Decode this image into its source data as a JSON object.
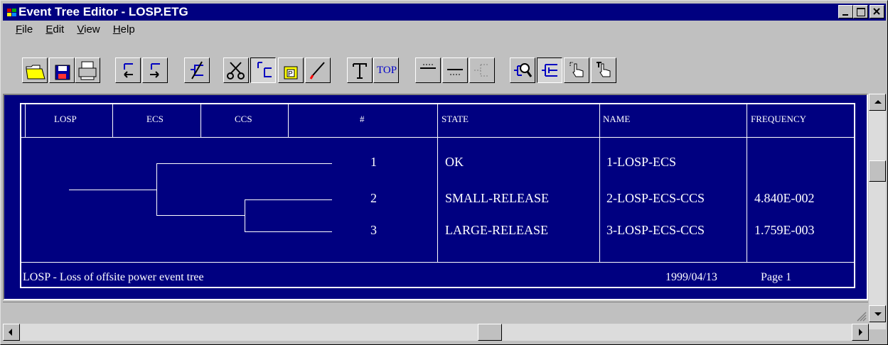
{
  "window": {
    "title": "Event Tree Editor - LOSP.ETG",
    "controls": [
      "minimize-icon",
      "maximize-icon",
      "close-icon"
    ]
  },
  "menu": [
    "File",
    "Edit",
    "View",
    "Help"
  ],
  "toolbar": {
    "top_label": "TOP",
    "buttons": [
      "open-icon",
      "save-icon",
      "print-icon",
      "move-left-icon",
      "move-right-icon",
      "branch-icon",
      "cut-icon",
      "copy-icon",
      "paste-icon",
      "draw-icon",
      "text-icon",
      "top-icon",
      "line-above-icon",
      "line-below-icon",
      "bracket-icon",
      "zoom-icon",
      "tree-icon",
      "hand-pointer-icon",
      "text-pointer-icon"
    ]
  },
  "table": {
    "headers": [
      "LOSP",
      "ECS",
      "CCS",
      "#",
      "STATE",
      "NAME",
      "FREQUENCY"
    ],
    "rows": [
      {
        "num": "1",
        "state": "OK",
        "name": "1-LOSP-ECS",
        "freq": ""
      },
      {
        "num": "2",
        "state": "SMALL-RELEASE",
        "name": "2-LOSP-ECS-CCS",
        "freq": "4.840E-002"
      },
      {
        "num": "3",
        "state": "LARGE-RELEASE",
        "name": "3-LOSP-ECS-CCS",
        "freq": "1.759E-003"
      }
    ],
    "footer": {
      "description": "LOSP -  Loss of offsite power event tree",
      "date": "1999/04/13",
      "page": "Page 1"
    }
  },
  "colors": {
    "background": "#000080",
    "foreground": "#ffffff",
    "chrome": "#c0c0c0"
  }
}
